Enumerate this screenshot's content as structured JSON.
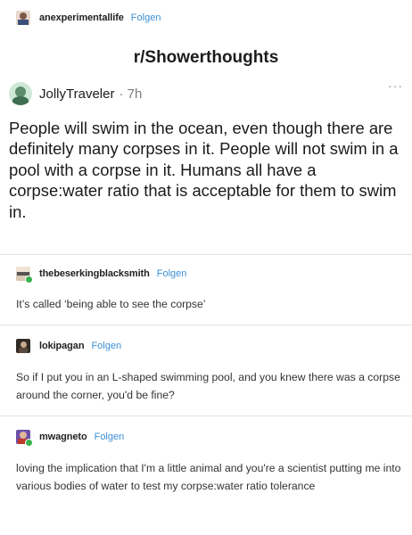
{
  "op": {
    "username": "anexperimentallife",
    "follow_label": "Folgen"
  },
  "reddit": {
    "subreddit": "r/Showerthoughts",
    "author": "JollyTraveler",
    "time": "· 7h",
    "more": "···",
    "body": "People will swim in the ocean, even though there are definitely many corpses in it. People will not swim in a pool with a corpse in it. Humans all have a corpse:water ratio that is acceptable for them to swim in."
  },
  "replies": [
    {
      "username": "thebeserkingblacksmith",
      "follow_label": "Folgen",
      "text": "It’s called ‘being able to see the corpse’"
    },
    {
      "username": "lokipagan",
      "follow_label": "Folgen",
      "text": "So if I put you in an L-shaped swimming pool, and you knew there was a corpse around the corner, you'd be fine?"
    },
    {
      "username": "mwagneto",
      "follow_label": "Folgen",
      "text": "loving the implication that I'm a little animal and you're a scientist putting me into various bodies of water to test my corpse:water ratio tolerance"
    }
  ],
  "colors": {
    "follow": "#3c8fd6",
    "badge": "#37b24d",
    "divider": "#e3e3e3"
  }
}
